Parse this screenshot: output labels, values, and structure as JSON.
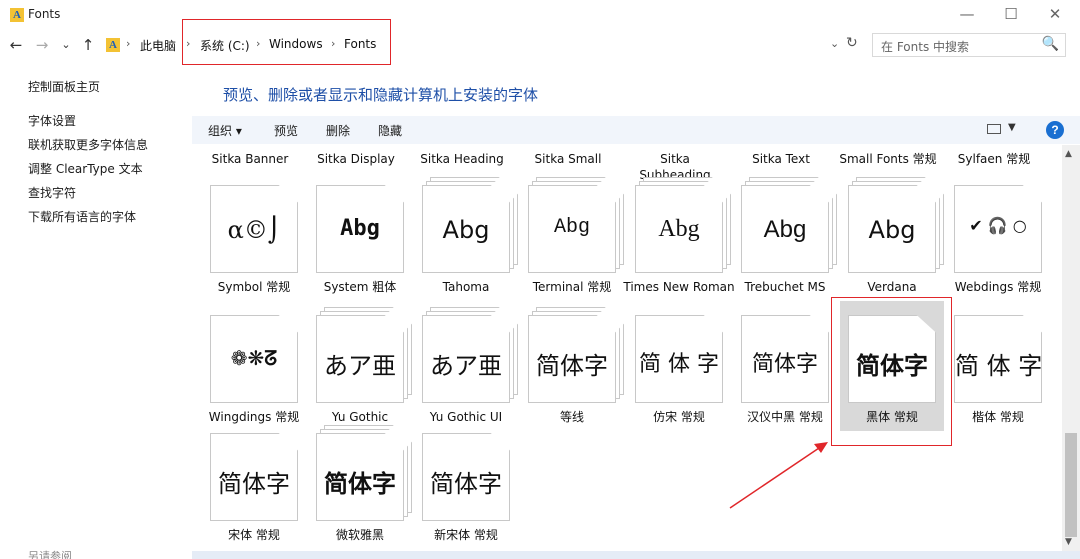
{
  "window": {
    "title": "Fonts",
    "controls": {
      "minimize": "—",
      "maximize": "☐",
      "close": "✕"
    }
  },
  "nav": {
    "back": "←",
    "forward": "→",
    "recent": "⌄",
    "up": "↑"
  },
  "address": {
    "items": [
      "此电脑",
      "系统 (C:)",
      "Windows",
      "Fonts"
    ],
    "separator": "›",
    "dropdown": "⌄",
    "refresh": "↻"
  },
  "search": {
    "placeholder": "在 Fonts 中搜索",
    "icon": "🔍"
  },
  "left_pane": {
    "home": "控制面板主页",
    "links": [
      "字体设置",
      "联机获取更多字体信息",
      "调整 ClearType 文本",
      "查找字符",
      "下载所有语言的字体"
    ],
    "bottom": "另请参阅"
  },
  "main": {
    "heading": "预览、删除或者显示和隐藏计算机上安装的字体"
  },
  "toolbar": {
    "organize": "组织 ▾",
    "preview": "预览",
    "delete": "删除",
    "hide": "隐藏",
    "view_dropdown": "▼",
    "help": "?"
  },
  "fonts_top_row": [
    "Sitka Banner",
    "Sitka Display",
    "Sitka Heading",
    "Sitka Small",
    "Sitka Subheading",
    "Sitka Text",
    "Small Fonts 常规",
    "Sylfaen 常规"
  ],
  "font_rows": [
    [
      {
        "label": "Symbol 常规",
        "sample": "α©⌡",
        "stack": false
      },
      {
        "label": "System 粗体",
        "sample": "Abg",
        "stack": false
      },
      {
        "label": "Tahoma",
        "sample": "Abg",
        "stack": true
      },
      {
        "label": "Terminal 常规",
        "sample": "Abg",
        "stack": true
      },
      {
        "label": "Times New Roman",
        "sample": "Abg",
        "stack": true
      },
      {
        "label": "Trebuchet MS",
        "sample": "Abg",
        "stack": true
      },
      {
        "label": "Verdana",
        "sample": "Abg",
        "stack": true
      },
      {
        "label": "Webdings 常规",
        "sample": "✔ 🎧 ○",
        "stack": false
      }
    ],
    [
      {
        "label": "Wingdings 常规",
        "sample": "❁❋ᘔ",
        "stack": false
      },
      {
        "label": "Yu Gothic",
        "sample": "あア亜",
        "stack": true
      },
      {
        "label": "Yu Gothic UI",
        "sample": "あア亜",
        "stack": true
      },
      {
        "label": "等线",
        "sample": "简体字",
        "stack": true
      },
      {
        "label": "仿宋 常规",
        "sample": "简 体 字",
        "stack": false
      },
      {
        "label": "汉仪中黑 常规",
        "sample": "简体字",
        "stack": false
      },
      {
        "label": "黑体 常规",
        "sample": "简体字",
        "stack": false,
        "selected": true
      },
      {
        "label": "楷体 常规",
        "sample": "简 体 字",
        "stack": false
      }
    ],
    [
      {
        "label": "宋体 常规",
        "sample": "简体字",
        "stack": false
      },
      {
        "label": "微软雅黑",
        "sample": "简体字",
        "stack": true
      },
      {
        "label": "新宋体 常规",
        "sample": "简体字",
        "stack": false
      }
    ]
  ],
  "scrollbar": {
    "up": "▲",
    "down": "▼"
  },
  "colors": {
    "accent": "#1e4fa7",
    "annotation": "#e0262a",
    "selection": "#d9d9d9"
  }
}
